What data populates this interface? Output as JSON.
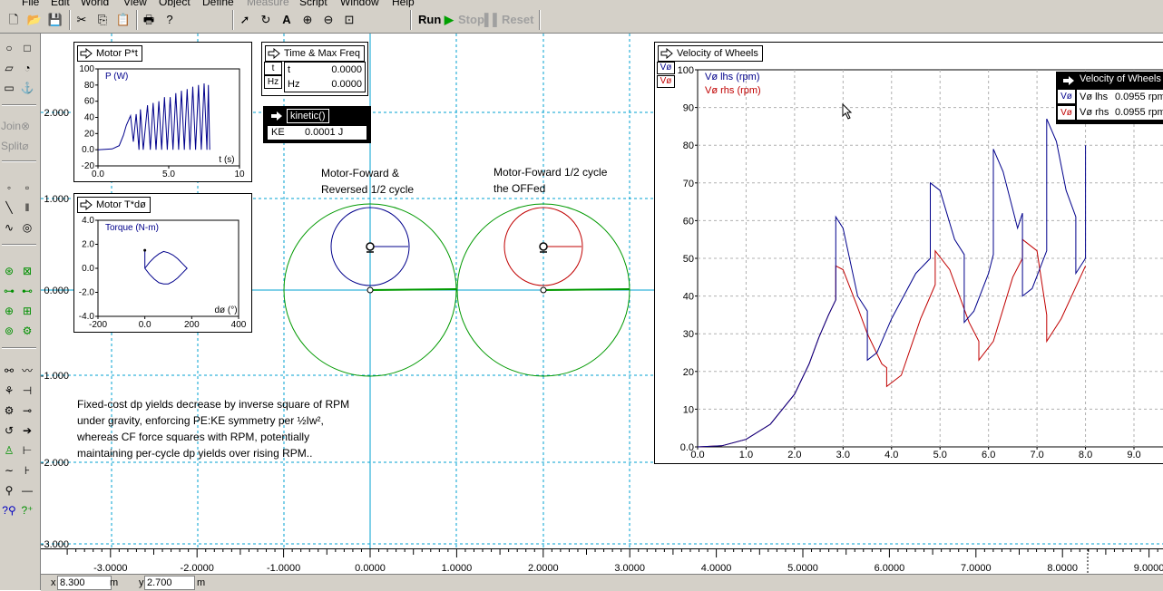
{
  "menu": [
    "File",
    "Edit",
    "World",
    "View",
    "Object",
    "Define",
    "Measure",
    "Script",
    "Window",
    "Help"
  ],
  "toolbar": {
    "run": "Run",
    "stop": "Stop",
    "reset": "Reset"
  },
  "palette": {
    "join": "Join",
    "split": "Split"
  },
  "world_axis": {
    "y_labels": [
      "2.000",
      "1.000",
      "0.000",
      "-1.000",
      "-2.000",
      "-3.000"
    ],
    "x_labels": [
      "-3.0000",
      "-2.0000",
      "-1.0000",
      "0.0000",
      "1.0000",
      "2.0000",
      "3.0000",
      "4.0000",
      "5.0000",
      "6.0000",
      "7.0000",
      "8.0000",
      "9.0000"
    ]
  },
  "panels": {
    "motor_power": {
      "title": "Motor P*t",
      "legend": "P (W)",
      "xlabel": "t (s)",
      "yticks": [
        "100",
        "80",
        "60",
        "40",
        "20",
        "0.0",
        "-20"
      ],
      "xticks": [
        "0.0",
        "5.0",
        "10"
      ]
    },
    "motor_torque": {
      "title": "Motor T*dø",
      "legend": "Torque (N-m)",
      "xlabel": "dø (°)",
      "yticks": [
        "4.0",
        "2.0",
        "0.0",
        "-2.0",
        "-4.0"
      ],
      "xticks": [
        "-200",
        "0.0",
        "200",
        "400"
      ]
    },
    "time_freq": {
      "title": "Time & Max Freq",
      "rows": [
        {
          "btn": "t",
          "label": "t",
          "value": "0.0000"
        },
        {
          "btn": "Hz",
          "label": "Hz",
          "value": "0.0000"
        }
      ]
    },
    "kinetic": {
      "title": "kinetic()",
      "label": "KE",
      "value": "0.0001 J"
    },
    "velocity": {
      "title": "Velocity of Wheels",
      "btn1": "Vø",
      "btn2": "Vø",
      "legend_lhs": "Vø lhs (rpm)",
      "legend_rhs": "Vø rhs (rpm)",
      "meter_title": "Velocity of Wheels",
      "meter_rows": [
        {
          "btn": "Vø",
          "label": "Vø lhs",
          "value": "0.0955 rpm"
        },
        {
          "btn": "Vø",
          "label": "Vø rhs",
          "value": "0.0955 rpm"
        }
      ],
      "yticks": [
        "100",
        "90",
        "80",
        "70",
        "60",
        "50",
        "40",
        "30",
        "20",
        "10",
        "0.0"
      ],
      "xticks": [
        "0.0",
        "1.0",
        "2.0",
        "3.0",
        "4.0",
        "5.0",
        "6.0",
        "7.0",
        "8.0",
        "9.0"
      ]
    }
  },
  "labels": {
    "left_title_1": "Motor-Foward &",
    "left_title_2": "Reversed 1/2 cycle",
    "right_title_1": "Motor-Foward 1/2 cycle",
    "right_title_2": "the OFFed",
    "note_1": "Fixed-cost dp yields decrease by inverse square of RPM",
    "note_2": "under gravity, enforcing PE:KE symmetry per ½Iw²,",
    "note_3": "whereas CF force squares with RPM, potentially",
    "note_4": "maintaining per-cycle dp yields over rising RPM.."
  },
  "status": {
    "x_label": "x",
    "x_value": "8.300",
    "x_unit": "m",
    "y_label": "y",
    "y_value": "2.700",
    "y_unit": "m"
  },
  "colors": {
    "lhs": "#00008b",
    "rhs": "#c00000",
    "orbit": "#009900",
    "axis": "#00a0d0",
    "grid": "#00a0d0"
  },
  "chart_data": [
    {
      "type": "line",
      "title": "Motor P*t",
      "xlabel": "t (s)",
      "ylabel": "P (W)",
      "xlim": [
        0,
        10
      ],
      "ylim": [
        -20,
        100
      ],
      "series": [
        {
          "name": "P (W)",
          "x": [
            0,
            1.0,
            1.5,
            1.8,
            2.0,
            2.3,
            2.5,
            2.7,
            2.9,
            3.0,
            3.2,
            3.5,
            3.7,
            3.9,
            4.1,
            4.3,
            4.5,
            4.7,
            4.9,
            5.1,
            5.3,
            5.5,
            5.7,
            5.9,
            6.1,
            6.3,
            6.5,
            6.7,
            6.9,
            7.1,
            7.3,
            7.5,
            7.7,
            7.8,
            7.9
          ],
          "y": [
            0,
            1,
            5,
            18,
            30,
            42,
            10,
            44,
            0,
            50,
            0,
            55,
            0,
            58,
            0,
            60,
            0,
            65,
            0,
            65,
            0,
            70,
            0,
            73,
            0,
            75,
            0,
            78,
            0,
            80,
            0,
            82,
            0,
            80,
            0
          ]
        }
      ]
    },
    {
      "type": "line",
      "title": "Motor T*dø",
      "xlabel": "dø (°)",
      "ylabel": "Torque (N-m)",
      "xlim": [
        -200,
        400
      ],
      "ylim": [
        -4,
        4
      ],
      "series": [
        {
          "name": "Torque (N-m)",
          "x": [
            0,
            20,
            40,
            60,
            80,
            100,
            120,
            140,
            160,
            180,
            160,
            140,
            120,
            100,
            80,
            60,
            40,
            20,
            0,
            0
          ],
          "y": [
            0,
            0.5,
            0.9,
            1.2,
            1.4,
            1.3,
            1.1,
            0.8,
            0.4,
            0.0,
            -0.4,
            -0.8,
            -1.1,
            -1.3,
            -1.3,
            -1.2,
            -0.9,
            -0.5,
            0,
            1.5
          ]
        }
      ]
    },
    {
      "type": "line",
      "title": "Velocity of Wheels",
      "xlim": [
        0,
        9.5
      ],
      "ylim": [
        0,
        100
      ],
      "series": [
        {
          "name": "Vø lhs (rpm)",
          "x": [
            0,
            0.5,
            1.0,
            1.5,
            2.0,
            2.3,
            2.5,
            2.7,
            2.85,
            2.85,
            3.0,
            3.3,
            3.5,
            3.5,
            3.7,
            4.0,
            4.5,
            4.8,
            4.8,
            5.0,
            5.3,
            5.5,
            5.5,
            5.7,
            6.0,
            6.1,
            6.1,
            6.3,
            6.6,
            6.7,
            6.7,
            6.9,
            7.2,
            7.2,
            7.4,
            7.6,
            7.8,
            7.8,
            8.0,
            8.0
          ],
          "y": [
            0,
            0.3,
            2,
            6,
            14,
            22,
            29,
            35,
            39,
            61,
            58,
            40,
            36,
            23,
            25,
            34,
            46,
            50,
            70,
            68,
            55,
            51,
            33,
            36,
            46,
            51,
            79,
            73,
            58,
            62,
            40,
            42,
            52,
            87,
            81,
            68,
            61,
            46,
            50,
            80
          ]
        },
        {
          "name": "Vø rhs (rpm)",
          "x": [
            0,
            0.5,
            1.0,
            1.5,
            2.0,
            2.3,
            2.5,
            2.7,
            2.85,
            2.85,
            3.0,
            3.3,
            3.5,
            3.8,
            3.9,
            3.9,
            4.2,
            4.6,
            4.9,
            4.9,
            5.2,
            5.6,
            5.8,
            5.8,
            6.1,
            6.5,
            6.7,
            6.7,
            7.0,
            7.2,
            7.2,
            7.5,
            8.0
          ],
          "y": [
            0,
            0.3,
            2,
            6,
            14,
            22,
            29,
            35,
            39,
            48,
            47,
            37,
            30,
            22,
            21,
            16,
            19,
            34,
            43,
            52,
            47,
            33,
            28,
            23,
            28,
            45,
            50,
            55,
            52,
            35,
            28,
            34,
            48
          ]
        }
      ]
    }
  ]
}
